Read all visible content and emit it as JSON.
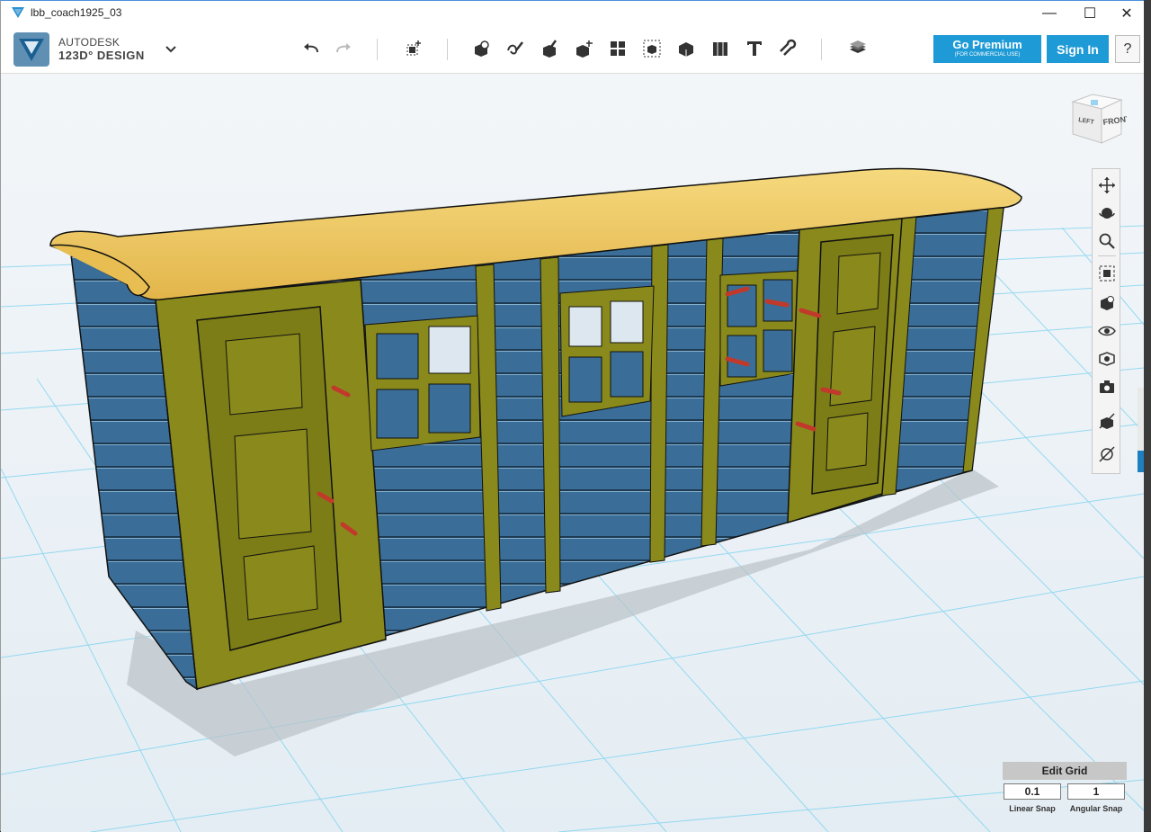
{
  "window": {
    "title": "lbb_coach1925_03"
  },
  "app": {
    "brand_line1": "AUTODESK",
    "brand_line2": "123D° DESIGN"
  },
  "toolbar": {
    "undo": "undo-icon",
    "redo": "redo-icon",
    "tools": [
      "transform-icon",
      "primitives-icon",
      "sketch-icon",
      "construct-icon",
      "modify-icon",
      "pattern-icon",
      "grouping-icon",
      "combine-icon",
      "measure-icon",
      "text-icon",
      "snap-icon",
      "material-icon"
    ]
  },
  "account": {
    "premium_label": "Go Premium",
    "premium_sub": "(FOR COMMERCIAL USE)",
    "signin_label": "Sign In",
    "help_label": "?"
  },
  "viewcube": {
    "left_label": "LEFT",
    "front_label": "FRONT"
  },
  "grid": {
    "header": "Edit Grid",
    "linear_value": "0.1",
    "angular_value": "1",
    "linear_label": "Linear Snap",
    "angular_label": "Angular Snap"
  },
  "colors": {
    "accent": "#1e9ad6",
    "grid_line": "#7fd3f0",
    "coach_body": "#3a6e98",
    "coach_trim": "#8a8a1c",
    "coach_roof": "#f2c95e"
  }
}
